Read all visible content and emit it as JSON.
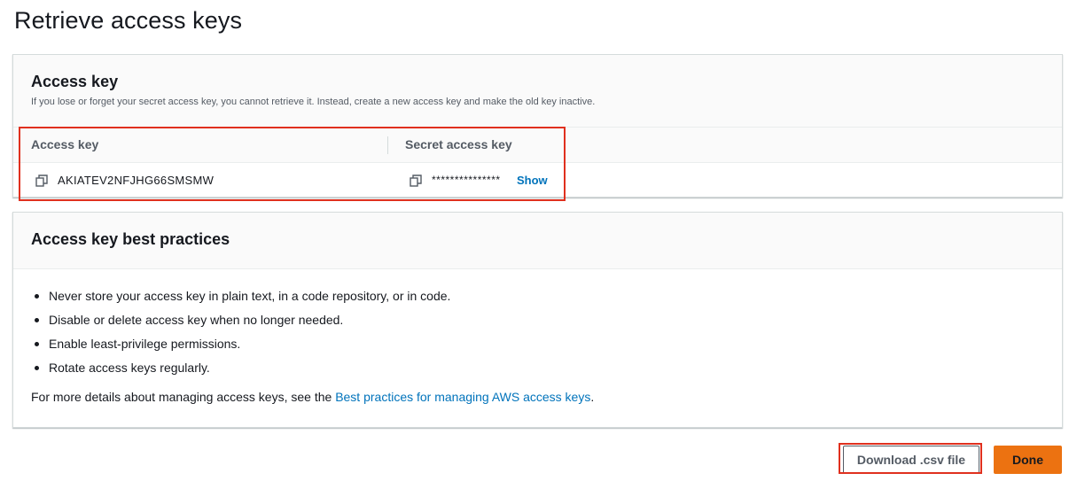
{
  "page": {
    "title": "Retrieve access keys"
  },
  "access_key_panel": {
    "heading": "Access key",
    "description": "If you lose or forget your secret access key, you cannot retrieve it. Instead, create a new access key and make the old key inactive.",
    "columns": {
      "access_key": "Access key",
      "secret_access_key": "Secret access key"
    },
    "access_key_value": "AKIATEV2NFJHG66SMSMW",
    "secret_masked": "***************",
    "show_label": "Show",
    "icons": {
      "copy": "copy-icon"
    }
  },
  "best_practices_panel": {
    "heading": "Access key best practices",
    "items": [
      "Never store your access key in plain text, in a code repository, or in code.",
      "Disable or delete access key when no longer needed.",
      "Enable least-privilege permissions.",
      "Rotate access keys regularly."
    ],
    "more_prefix": "For more details about managing access keys, see the ",
    "more_link": "Best practices for managing AWS access keys",
    "more_suffix": "."
  },
  "actions": {
    "download_label": "Download .csv file",
    "done_label": "Done"
  },
  "colors": {
    "accent": "#ec7211",
    "link": "#0073bb",
    "highlight": "#e0301e"
  }
}
